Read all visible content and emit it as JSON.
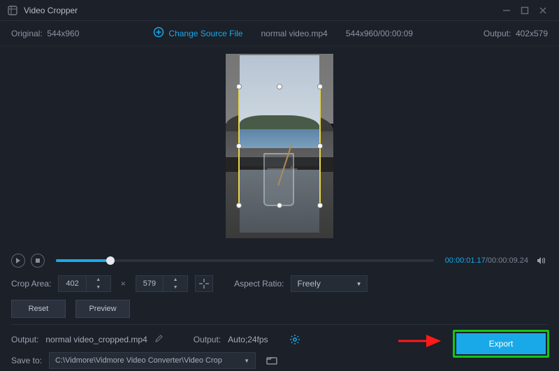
{
  "titlebar": {
    "app_title": "Video Cropper"
  },
  "infobar": {
    "original_label": "Original:",
    "original_dim": "544x960",
    "change_source": "Change Source File",
    "filename": "normal video.mp4",
    "src_dim_time": "544x960/00:00:09",
    "output_label": "Output:",
    "output_dim": "402x579"
  },
  "player": {
    "current_time": "00:00:01.17",
    "total_time": "00:00:09.24"
  },
  "crop": {
    "area_label": "Crop Area:",
    "width": "402",
    "height": "579",
    "aspect_label": "Aspect Ratio:",
    "aspect_value": "Freely"
  },
  "buttons": {
    "reset": "Reset",
    "preview": "Preview",
    "export": "Export"
  },
  "output": {
    "output_label": "Output:",
    "output_file": "normal video_cropped.mp4",
    "settings_label": "Output:",
    "settings_value": "Auto;24fps",
    "save_label": "Save to:",
    "save_path": "C:\\Vidmore\\Vidmore Video Converter\\Video Crop"
  }
}
